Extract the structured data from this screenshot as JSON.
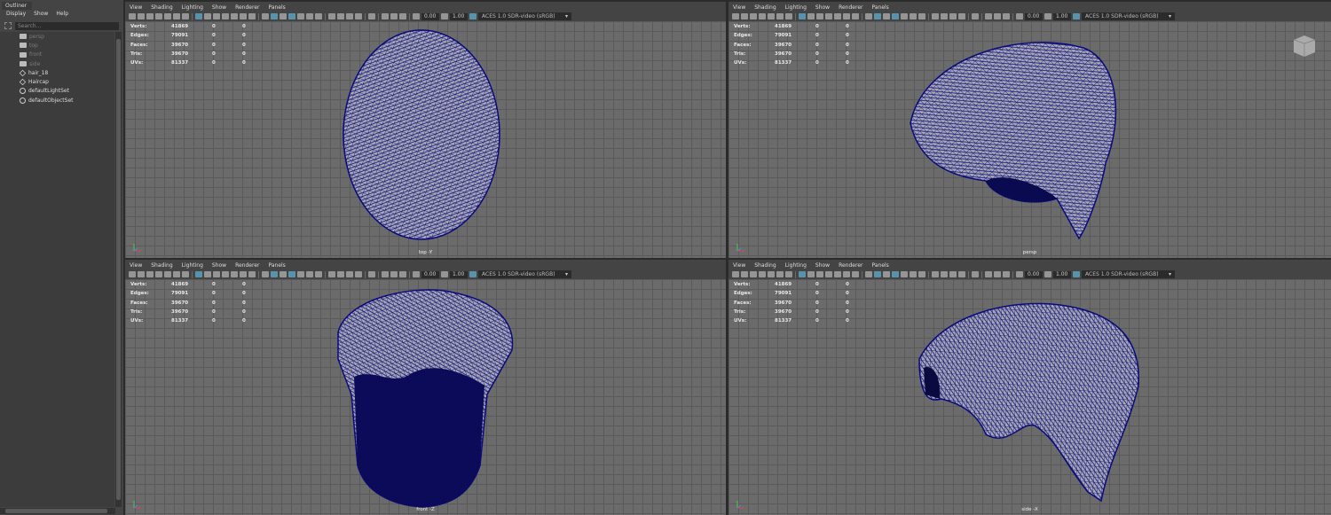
{
  "outliner": {
    "tab": "Outliner",
    "menu": [
      "Display",
      "Show",
      "Help"
    ],
    "search_placeholder": "Search...",
    "items": [
      {
        "label": "persp",
        "icon": "camera-icon",
        "dim": true
      },
      {
        "label": "top",
        "icon": "camera-icon",
        "dim": true
      },
      {
        "label": "front",
        "icon": "camera-icon",
        "dim": true
      },
      {
        "label": "side",
        "icon": "camera-icon",
        "dim": true
      },
      {
        "label": "hair_18",
        "icon": "transform-icon",
        "dim": false
      },
      {
        "label": "Haircap",
        "icon": "transform-icon",
        "dim": false
      },
      {
        "label": "defaultLightSet",
        "icon": "set-icon",
        "dim": false
      },
      {
        "label": "defaultObjectSet",
        "icon": "set-icon",
        "dim": false
      }
    ]
  },
  "viewport_menu": [
    "View",
    "Shading",
    "Lighting",
    "Show",
    "Renderer",
    "Panels"
  ],
  "toolbar": {
    "exposure": "0.00",
    "gamma": "1.00",
    "color_space": "ACES 1.0 SDR-video (sRGB)"
  },
  "hud": [
    {
      "label": "Verts:",
      "v": [
        "41869",
        "0",
        "0"
      ]
    },
    {
      "label": "Edges:",
      "v": [
        "79091",
        "0",
        "0"
      ]
    },
    {
      "label": "Faces:",
      "v": [
        "39670",
        "0",
        "0"
      ]
    },
    {
      "label": "Tris:",
      "v": [
        "39670",
        "0",
        "0"
      ]
    },
    {
      "label": "UVs:",
      "v": [
        "81337",
        "0",
        "0"
      ]
    }
  ],
  "viewports": [
    {
      "label": "top -Y"
    },
    {
      "label": "persp"
    },
    {
      "label": "front -Z"
    },
    {
      "label": "side -X"
    }
  ],
  "colors": {
    "wire": "#0a0a7a",
    "mesh": "#a8a8b4",
    "viewport_bg": "#6b6b6b",
    "accent": "#5da8c8"
  }
}
